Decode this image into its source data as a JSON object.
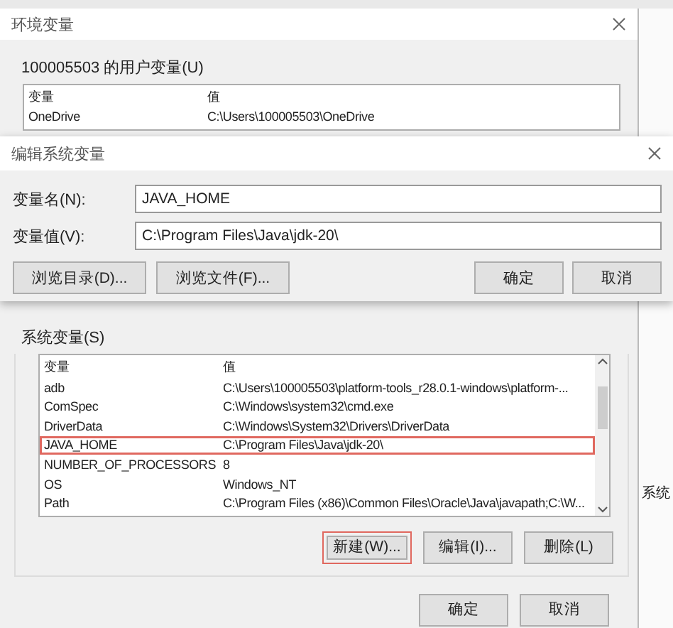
{
  "main_window": {
    "title": "环境变量"
  },
  "user_variables": {
    "label": "100005503 的用户变量(U)",
    "columns": [
      "变量",
      "值"
    ],
    "rows": [
      {
        "name": "OneDrive",
        "value": "C:\\Users\\100005503\\OneDrive"
      }
    ]
  },
  "edit_dialog": {
    "title": "编辑系统变量",
    "fields": [
      {
        "label": "变量名(N):",
        "value": "JAVA_HOME"
      },
      {
        "label": "变量值(V):",
        "value": "C:\\Program Files\\Java\\jdk-20\\"
      }
    ],
    "left_buttons": [
      "浏览目录(D)...",
      "浏览文件(F)..."
    ],
    "right_buttons": [
      "确定",
      "取消"
    ]
  },
  "system_variables": {
    "label": "系统变量(S)",
    "columns": [
      "变量",
      "值"
    ],
    "rows": [
      {
        "name": "adb",
        "value": "C:\\Users\\100005503\\platform-tools_r28.0.1-windows\\platform-...",
        "highlighted": false
      },
      {
        "name": "ComSpec",
        "value": "C:\\Windows\\system32\\cmd.exe",
        "highlighted": false
      },
      {
        "name": "DriverData",
        "value": "C:\\Windows\\System32\\Drivers\\DriverData",
        "highlighted": false
      },
      {
        "name": "JAVA_HOME",
        "value": "C:\\Program Files\\Java\\jdk-20\\",
        "highlighted": true
      },
      {
        "name": "NUMBER_OF_PROCESSORS",
        "value": "8",
        "highlighted": false
      },
      {
        "name": "OS",
        "value": "Windows_NT",
        "highlighted": false
      },
      {
        "name": "Path",
        "value": "C:\\Program Files (x86)\\Common Files\\Oracle\\Java\\javapath;C:\\W...",
        "highlighted": false
      }
    ],
    "buttons": [
      {
        "label": "新建(W)...",
        "highlighted": true
      },
      {
        "label": "编辑(I)...",
        "highlighted": false
      },
      {
        "label": "删除(L)",
        "highlighted": false
      }
    ]
  },
  "dialog_buttons": [
    "确定",
    "取消"
  ],
  "background_window": {
    "text": "系统"
  }
}
